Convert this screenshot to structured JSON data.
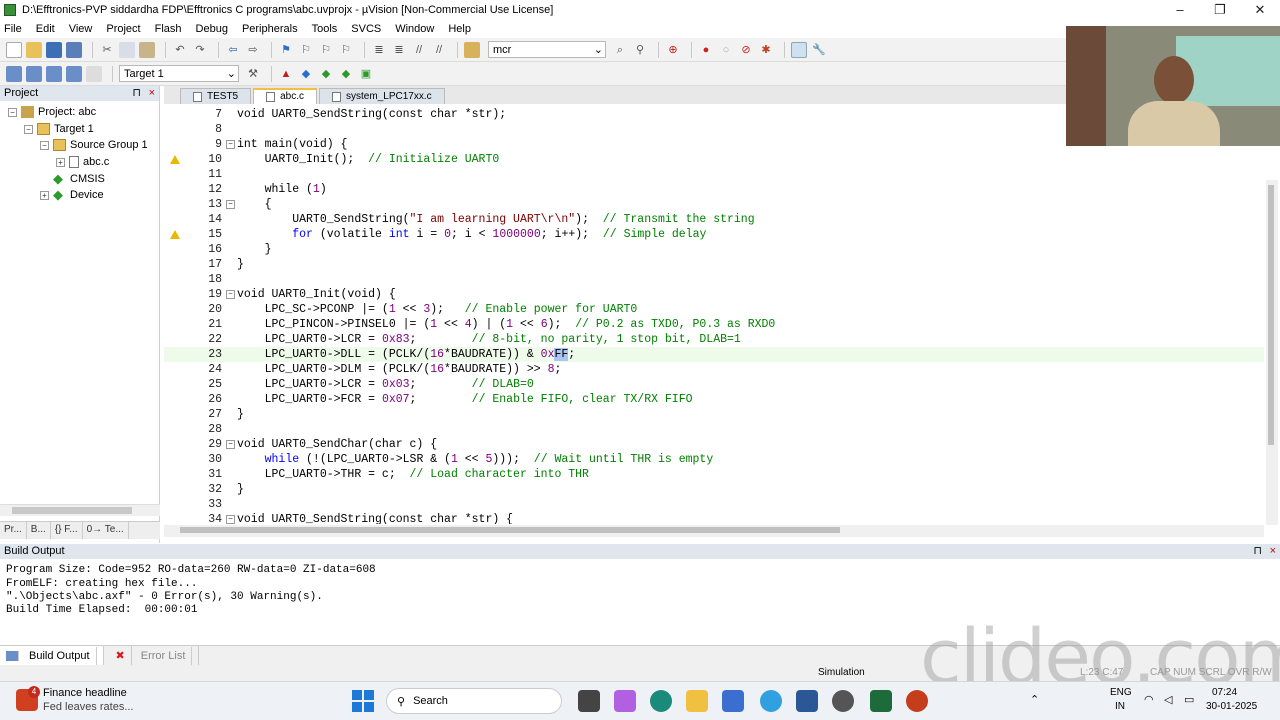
{
  "window": {
    "title": "D:\\Efftronics-PVP siddardha FDP\\Efftronics C programs\\abc.uvprojx - µVision  [Non-Commercial Use License]",
    "minimize": "–",
    "maximize": "❐",
    "close": "✕"
  },
  "menu": [
    "File",
    "Edit",
    "View",
    "Project",
    "Flash",
    "Debug",
    "Peripherals",
    "Tools",
    "SVCS",
    "Window",
    "Help"
  ],
  "toolbar": {
    "find_value": "mcr",
    "target": "Target 1"
  },
  "project": {
    "header": "Project",
    "pin": "⊓",
    "close": "×",
    "items": [
      {
        "label": "Project: abc"
      },
      {
        "label": "Target 1"
      },
      {
        "label": "Source Group 1"
      },
      {
        "label": "abc.c"
      },
      {
        "label": "CMSIS"
      },
      {
        "label": "Device"
      }
    ],
    "tabs": [
      "Pr...",
      "B...",
      "{} F...",
      "0→ Te..."
    ]
  },
  "tabs": [
    "TEST5",
    "abc.c",
    "system_LPC17xx.c"
  ],
  "code": [
    {
      "n": "7",
      "fold": "",
      "warn": false,
      "hl": false
    },
    {
      "n": "8",
      "fold": "",
      "warn": false,
      "hl": false
    },
    {
      "n": "9",
      "fold": "⊟",
      "warn": false,
      "hl": false
    },
    {
      "n": "10",
      "fold": "",
      "warn": true,
      "hl": false
    },
    {
      "n": "11",
      "fold": "",
      "warn": false,
      "hl": false
    },
    {
      "n": "12",
      "fold": "",
      "warn": false,
      "hl": false
    },
    {
      "n": "13",
      "fold": "⊟",
      "warn": false,
      "hl": false
    },
    {
      "n": "14",
      "fold": "",
      "warn": false,
      "hl": false
    },
    {
      "n": "15",
      "fold": "",
      "warn": true,
      "hl": false
    },
    {
      "n": "16",
      "fold": "",
      "warn": false,
      "hl": false
    },
    {
      "n": "17",
      "fold": "",
      "warn": false,
      "hl": false
    },
    {
      "n": "18",
      "fold": "",
      "warn": false,
      "hl": false
    },
    {
      "n": "19",
      "fold": "⊟",
      "warn": false,
      "hl": false
    },
    {
      "n": "20",
      "fold": "",
      "warn": false,
      "hl": false
    },
    {
      "n": "21",
      "fold": "",
      "warn": false,
      "hl": false
    },
    {
      "n": "22",
      "fold": "",
      "warn": false,
      "hl": false
    },
    {
      "n": "23",
      "fold": "",
      "warn": false,
      "hl": true
    },
    {
      "n": "24",
      "fold": "",
      "warn": false,
      "hl": false
    },
    {
      "n": "25",
      "fold": "",
      "warn": false,
      "hl": false
    },
    {
      "n": "26",
      "fold": "",
      "warn": false,
      "hl": false
    },
    {
      "n": "27",
      "fold": "",
      "warn": false,
      "hl": false
    },
    {
      "n": "28",
      "fold": "",
      "warn": false,
      "hl": false
    },
    {
      "n": "29",
      "fold": "⊟",
      "warn": false,
      "hl": false
    },
    {
      "n": "30",
      "fold": "",
      "warn": false,
      "hl": false
    },
    {
      "n": "31",
      "fold": "",
      "warn": false,
      "hl": false
    },
    {
      "n": "32",
      "fold": "",
      "warn": false,
      "hl": false
    },
    {
      "n": "33",
      "fold": "",
      "warn": false,
      "hl": false
    },
    {
      "n": "34",
      "fold": "⊟",
      "warn": false,
      "hl": false
    }
  ],
  "code_text": [
    [
      [
        "",
        "void UART0_SendString(const char *str);"
      ]
    ],
    [
      [
        "",
        ""
      ]
    ],
    [
      [
        "",
        "int main(void) {"
      ]
    ],
    [
      [
        "",
        "    UART0_Init();  "
      ],
      [
        "cm",
        "// Initialize UART0"
      ]
    ],
    [
      [
        "",
        ""
      ]
    ],
    [
      [
        "",
        "    while ("
      ],
      [
        "nm",
        "1"
      ],
      [
        "",
        ")"
      ]
    ],
    [
      [
        "",
        "    {"
      ]
    ],
    [
      [
        "",
        "        UART0_SendString("
      ],
      [
        "st",
        "\"I am learning UART\\r\\n\""
      ],
      [
        "",
        ");  "
      ],
      [
        "cm",
        "// Transmit the string"
      ]
    ],
    [
      [
        "",
        "        "
      ],
      [
        "kw",
        "for"
      ],
      [
        "",
        " (volatile "
      ],
      [
        "kw",
        "int"
      ],
      [
        "",
        " i = "
      ],
      [
        "nm",
        "0"
      ],
      [
        "",
        "; i < "
      ],
      [
        "nm",
        "1000000"
      ],
      [
        "",
        "; i++);  "
      ],
      [
        "cm",
        "// Simple delay"
      ]
    ],
    [
      [
        "",
        "    }"
      ]
    ],
    [
      [
        "",
        "}"
      ]
    ],
    [
      [
        "",
        ""
      ]
    ],
    [
      [
        "",
        "void UART0_Init(void) {"
      ]
    ],
    [
      [
        "",
        "    LPC_SC->PCONP |= ("
      ],
      [
        "nm",
        "1"
      ],
      [
        "",
        " << "
      ],
      [
        "nm",
        "3"
      ],
      [
        "",
        ");   "
      ],
      [
        "cm",
        "// Enable power for UART0"
      ]
    ],
    [
      [
        "",
        "    LPC_PINCON->PINSEL0 |= ("
      ],
      [
        "nm",
        "1"
      ],
      [
        "",
        " << "
      ],
      [
        "nm",
        "4"
      ],
      [
        "",
        ") | ("
      ],
      [
        "nm",
        "1"
      ],
      [
        "",
        " << "
      ],
      [
        "nm",
        "6"
      ],
      [
        "",
        ");  "
      ],
      [
        "cm",
        "// P0.2 as TXD0, P0.3 as RXD0"
      ]
    ],
    [
      [
        "",
        "    LPC_UART0->LCR = "
      ],
      [
        "nm",
        "0x83"
      ],
      [
        "",
        ";        "
      ],
      [
        "cm",
        "// 8-bit, no parity, 1 stop bit, DLAB=1"
      ]
    ],
    [
      [
        "",
        "    LPC_UART0->DLL = (PCLK/("
      ],
      [
        "nm",
        "16"
      ],
      [
        "",
        "*BAUDRATE)) & "
      ],
      [
        "nm",
        "0x"
      ],
      [
        "sel",
        "FF"
      ],
      [
        "",
        ";"
      ]
    ],
    [
      [
        "",
        "    LPC_UART0->DLM = (PCLK/("
      ],
      [
        "nm",
        "16"
      ],
      [
        "",
        "*BAUDRATE)) >> "
      ],
      [
        "nm",
        "8"
      ],
      [
        "",
        ";"
      ]
    ],
    [
      [
        "",
        "    LPC_UART0->LCR = "
      ],
      [
        "nm",
        "0x03"
      ],
      [
        "",
        ";        "
      ],
      [
        "cm",
        "// DLAB=0"
      ]
    ],
    [
      [
        "",
        "    LPC_UART0->FCR = "
      ],
      [
        "nm",
        "0x07"
      ],
      [
        "",
        ";        "
      ],
      [
        "cm",
        "// Enable FIFO, clear TX/RX FIFO"
      ]
    ],
    [
      [
        "",
        "}"
      ]
    ],
    [
      [
        "",
        ""
      ]
    ],
    [
      [
        "",
        "void UART0_SendChar(char c) {"
      ]
    ],
    [
      [
        "",
        "    "
      ],
      [
        "kw",
        "while"
      ],
      [
        "",
        " (!(LPC_UART0->LSR & ("
      ],
      [
        "nm",
        "1"
      ],
      [
        "",
        " << "
      ],
      [
        "nm",
        "5"
      ],
      [
        "",
        ")));  "
      ],
      [
        "cm",
        "// Wait until THR is empty"
      ]
    ],
    [
      [
        "",
        "    LPC_UART0->THR = c;  "
      ],
      [
        "cm",
        "// Load character into THR"
      ]
    ],
    [
      [
        "",
        "}"
      ]
    ],
    [
      [
        "",
        ""
      ]
    ],
    [
      [
        "",
        "void UART0_SendString(const char *str) {"
      ]
    ]
  ],
  "build": {
    "header": "Build Output",
    "lines": [
      "Program Size: Code=952 RO-data=260 RW-data=0 ZI-data=608",
      "FromELF: creating hex file...",
      "\".\\Objects\\abc.axf\" - 0 Error(s), 30 Warning(s).",
      "Build Time Elapsed:  00:00:01"
    ],
    "tabs": [
      "Build Output",
      "Error List"
    ]
  },
  "status": {
    "mode": "Simulation",
    "pos": "L:23 C:47",
    "flags": "CAP  NUM  SCRL  OVR  R/W"
  },
  "taskbar": {
    "news_title": "Finance headline",
    "news_sub": "Fed leaves rates...",
    "badge": "4",
    "search": "Search",
    "lang1": "ENG",
    "lang2": "IN",
    "time": "07:24",
    "date": "30-01-2025"
  },
  "watermark": "clideo.com"
}
